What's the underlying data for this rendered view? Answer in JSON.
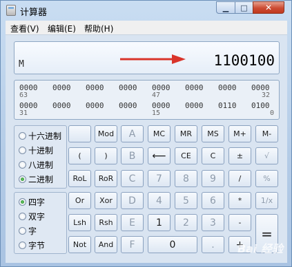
{
  "window": {
    "title": "计算器"
  },
  "menu": [
    "查看(V)",
    "编辑(E)",
    "帮助(H)"
  ],
  "display": {
    "memory_indicator": "M",
    "value": "1100100",
    "arrow_color": "#d9342a"
  },
  "bits": {
    "row1": [
      "0000",
      "0000",
      "0000",
      "0000",
      "0000",
      "0000",
      "0000",
      "0000"
    ],
    "row1_positions": [
      "63",
      "47",
      "32"
    ],
    "row2": [
      "0000",
      "0000",
      "0000",
      "0000",
      "0000",
      "0000",
      "0110",
      "0100"
    ],
    "row2_positions": [
      "31",
      "15",
      "0"
    ]
  },
  "radix": {
    "options": [
      "十六进制",
      "十进制",
      "八进制",
      "二进制"
    ],
    "selected": "二进制"
  },
  "word_size": {
    "options": [
      "四字",
      "双字",
      "字",
      "字节"
    ],
    "selected": "四字"
  },
  "keys": {
    "blank": "",
    "mod": "Mod",
    "A": "A",
    "MC": "MC",
    "MR": "MR",
    "MS": "MS",
    "Mplus": "M+",
    "Mminus": "M-",
    "lparen": "(",
    "rparen": ")",
    "B": "B",
    "back": "⟵",
    "CE": "CE",
    "C": "C",
    "pm": "±",
    "sqrt": "√",
    "RoL": "RoL",
    "RoR": "RoR",
    "Ckey": "C",
    "seven": "7",
    "eight": "8",
    "nine": "9",
    "div": "/",
    "pct": "%",
    "Or": "Or",
    "Xor": "Xor",
    "D": "D",
    "four": "4",
    "five": "5",
    "six": "6",
    "mul": "*",
    "recip": "1/x",
    "Lsh": "Lsh",
    "Rsh": "Rsh",
    "E": "E",
    "one": "1",
    "two": "2",
    "three": "3",
    "minus": "-",
    "equals": "=",
    "Not": "Not",
    "And": "And",
    "F": "F",
    "zero": "0",
    "dot": ".",
    "plus": "+"
  },
  "watermark": "Bai 经验"
}
